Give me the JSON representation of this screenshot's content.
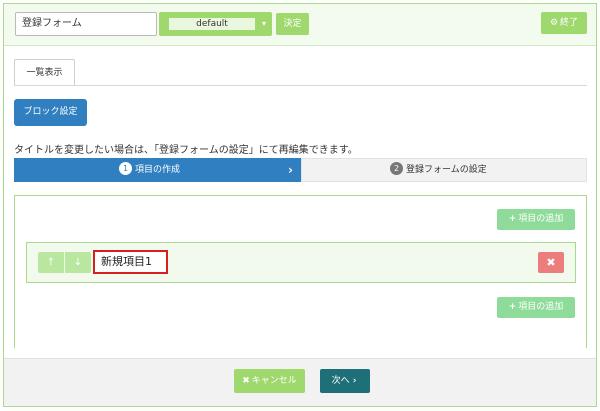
{
  "header": {
    "form_title": "登録フォーム",
    "template_select": {
      "selected": "default",
      "caret": "▾"
    },
    "decide_label": "決定",
    "exit_icon": "gear-icon",
    "exit_label": "終了"
  },
  "tabs": [
    {
      "label": "一覧表示",
      "active": true
    }
  ],
  "block_settings_label": "ブロック設定",
  "hint_text": "タイトルを変更したい場合は、「登録フォームの設定」にて再編集できます。",
  "steps": [
    {
      "number": "1",
      "label": "項目の作成",
      "active": true
    },
    {
      "number": "2",
      "label": "登録フォームの設定",
      "active": false
    }
  ],
  "item_panel": {
    "add_item_label": "項目の追加",
    "items": [
      {
        "name": "新規項目1"
      }
    ]
  },
  "footer": {
    "cancel_label": "キャンセル",
    "next_label": "次へ"
  },
  "colors": {
    "accent_green": "#9fd96e",
    "primary_blue": "#2f7fc1",
    "danger_red": "#ec7d7d",
    "next_teal": "#1f6f78",
    "highlight_border": "#d62020"
  }
}
